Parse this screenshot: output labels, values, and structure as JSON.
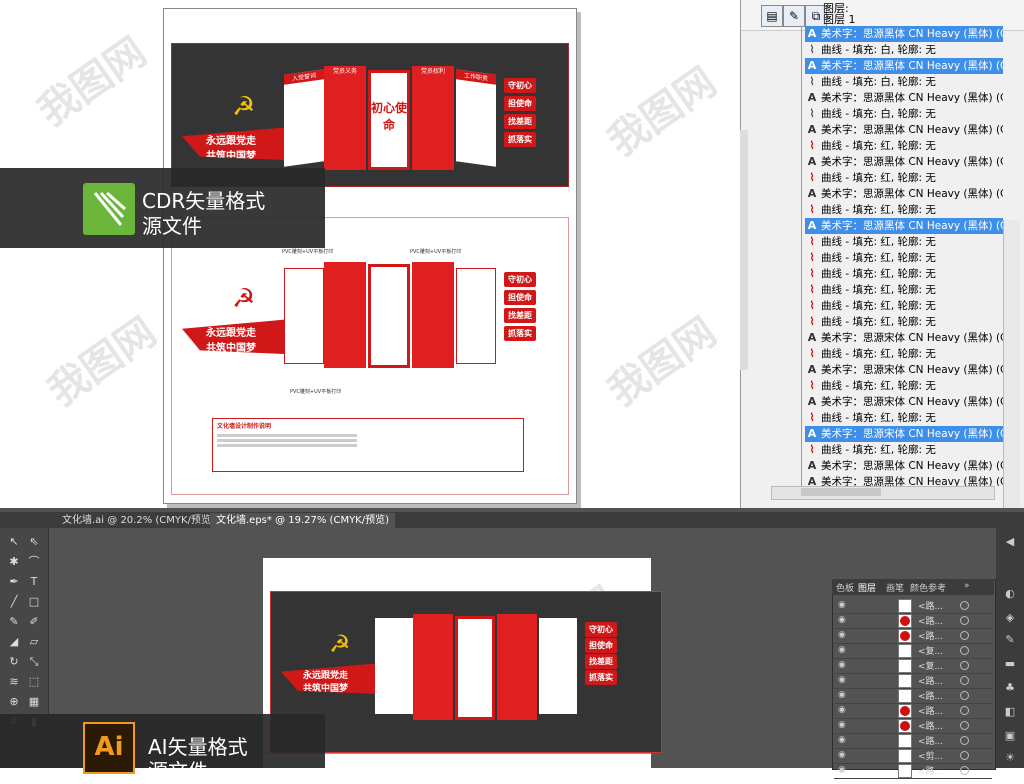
{
  "cdr": {
    "label_line1": "CDR矢量格式",
    "label_line2": "源文件",
    "design_top": {
      "banner": "永远跟党走",
      "banner2": "共筑中国梦",
      "signs": [
        "守初心",
        "担使命",
        "找差距",
        "抓落实"
      ],
      "panel_titles": [
        "入党誓词",
        "党员义务",
        "初心使命",
        "党员权利",
        "工作职责"
      ]
    },
    "design_bottom": {
      "banner": "永远跟党走",
      "banner2": "共筑中国梦",
      "signs": [
        "守初心",
        "担使命",
        "找差距",
        "抓落实"
      ],
      "annotations": [
        "PVC雕刻+UV平板打印",
        "PVC雕刻+UV平板打印",
        "PVC雕刻+UV平板打印"
      ],
      "notes_title": "文化墙设计制作说明"
    }
  },
  "object_manager": {
    "layer_label": "图层:",
    "layer_name": "图层 1",
    "rows": [
      {
        "icon": "A",
        "type": "art-text",
        "text": "美术字：思源黑体 CN Heavy (黑体) (CH",
        "selected": true
      },
      {
        "icon": "curve-white",
        "type": "curve",
        "text": "曲线 - 填充: 白, 轮廓: 无",
        "selected": false
      },
      {
        "icon": "A",
        "type": "art-text",
        "text": "美术字：思源黑体 CN Heavy (黑体) (CH",
        "selected": true
      },
      {
        "icon": "curve-white",
        "type": "curve",
        "text": "曲线 - 填充: 白, 轮廓: 无",
        "selected": false
      },
      {
        "icon": "A",
        "type": "art-text",
        "text": "美术字：思源黑体 CN Heavy (黑体) (CH",
        "selected": false
      },
      {
        "icon": "curve-white",
        "type": "curve",
        "text": "曲线 - 填充: 白, 轮廓: 无",
        "selected": false
      },
      {
        "icon": "A",
        "type": "art-text",
        "text": "美术字：思源黑体 CN Heavy (黑体) (CH",
        "selected": false
      },
      {
        "icon": "curve-red",
        "type": "curve",
        "text": "曲线 - 填充: 红, 轮廓: 无",
        "selected": false
      },
      {
        "icon": "A",
        "type": "art-text",
        "text": "美术字：思源黑体 CN Heavy (黑体) (CH",
        "selected": false
      },
      {
        "icon": "curve-red",
        "type": "curve",
        "text": "曲线 - 填充: 红, 轮廓: 无",
        "selected": false
      },
      {
        "icon": "A",
        "type": "art-text",
        "text": "美术字：思源黑体 CN Heavy (黑体) (CH",
        "selected": false
      },
      {
        "icon": "curve-red",
        "type": "curve",
        "text": "曲线 - 填充: 红, 轮廓: 无",
        "selected": false
      },
      {
        "icon": "A",
        "type": "art-text",
        "text": "美术字：思源黑体 CN Heavy (黑体) (CH",
        "selected": true
      },
      {
        "icon": "curve-red",
        "type": "curve",
        "text": "曲线 - 填充: 红, 轮廓: 无",
        "selected": false
      },
      {
        "icon": "curve-red",
        "type": "curve",
        "text": "曲线 - 填充: 红, 轮廓: 无",
        "selected": false
      },
      {
        "icon": "curve-red",
        "type": "curve",
        "text": "曲线 - 填充: 红, 轮廓: 无",
        "selected": false
      },
      {
        "icon": "curve-red",
        "type": "curve",
        "text": "曲线 - 填充: 红, 轮廓: 无",
        "selected": false
      },
      {
        "icon": "curve-red",
        "type": "curve",
        "text": "曲线 - 填充: 红, 轮廓: 无",
        "selected": false
      },
      {
        "icon": "curve-red",
        "type": "curve",
        "text": "曲线 - 填充: 红, 轮廓: 无",
        "selected": false
      },
      {
        "icon": "A",
        "type": "art-text",
        "text": "美术字：思源宋体 CN Heavy (黑体) (CHC) -",
        "selected": false
      },
      {
        "icon": "curve-red",
        "type": "curve",
        "text": "曲线 - 填充: 红, 轮廓: 无",
        "selected": false
      },
      {
        "icon": "A",
        "type": "art-text",
        "text": "美术字：思源宋体 CN Heavy (黑体) (CH",
        "selected": false
      },
      {
        "icon": "curve-red",
        "type": "curve",
        "text": "曲线 - 填充: 红, 轮廓: 无",
        "selected": false
      },
      {
        "icon": "A",
        "type": "art-text",
        "text": "美术字：思源宋体 CN Heavy (黑体) (CH",
        "selected": false
      },
      {
        "icon": "curve-red",
        "type": "curve",
        "text": "曲线 - 填充: 红, 轮廓: 无",
        "selected": false
      },
      {
        "icon": "A",
        "type": "art-text",
        "text": "美术字：思源宋体 CN Heavy (黑体) (CH",
        "selected": true
      },
      {
        "icon": "curve-red",
        "type": "curve",
        "text": "曲线 - 填充: 红, 轮廓: 无",
        "selected": false
      },
      {
        "icon": "A",
        "type": "art-text",
        "text": "美术字：思源黑体 CN Heavy (黑体) (CH",
        "selected": false
      },
      {
        "icon": "A",
        "type": "art-text",
        "text": "美术字：思源黑体 CN Heavy (黑体) (CH",
        "selected": false
      },
      {
        "icon": "curve-red",
        "type": "curve",
        "text": "曲线 - 填充: 红, 轮廓: 无",
        "selected": false
      }
    ]
  },
  "ai": {
    "tab1": "文化墙.ai @ 20.2% (CMYK/预览)",
    "tab2": "文化墙.eps* @ 19.27% (CMYK/预览)",
    "label_line1": "AI矢量格式",
    "label_line2": "源文件",
    "layers_tabs": [
      "色板",
      "图层",
      "画笔",
      "颜色参考"
    ],
    "layer_rows": [
      {
        "thumb": "white",
        "name": "<路..."
      },
      {
        "thumb": "red",
        "name": "<路..."
      },
      {
        "thumb": "red",
        "name": "<路..."
      },
      {
        "thumb": "white",
        "name": "<复..."
      },
      {
        "thumb": "white",
        "name": "<复..."
      },
      {
        "thumb": "white",
        "name": "<路..."
      },
      {
        "thumb": "white",
        "name": "<路..."
      },
      {
        "thumb": "red",
        "name": "<路..."
      },
      {
        "thumb": "red",
        "name": "<路..."
      },
      {
        "thumb": "white",
        "name": "<路..."
      },
      {
        "thumb": "white",
        "name": "<剪..."
      },
      {
        "thumb": "white",
        "name": "<路..."
      }
    ]
  },
  "colors": {
    "brand_red": "#d01818",
    "selection_blue": "#3f8ee8",
    "dark_bg": "#343434",
    "cdr_green": "#6ab53a",
    "ai_orange": "#f29a1f"
  }
}
